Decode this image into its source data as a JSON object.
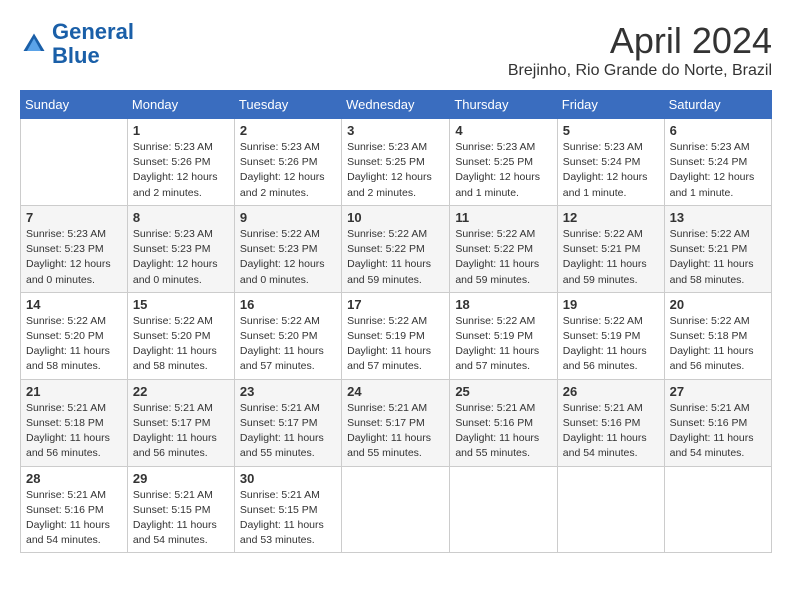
{
  "header": {
    "logo_line1": "General",
    "logo_line2": "Blue",
    "month_title": "April 2024",
    "subtitle": "Brejinho, Rio Grande do Norte, Brazil"
  },
  "weekdays": [
    "Sunday",
    "Monday",
    "Tuesday",
    "Wednesday",
    "Thursday",
    "Friday",
    "Saturday"
  ],
  "weeks": [
    [
      {
        "day": "",
        "info": ""
      },
      {
        "day": "1",
        "info": "Sunrise: 5:23 AM\nSunset: 5:26 PM\nDaylight: 12 hours\nand 2 minutes."
      },
      {
        "day": "2",
        "info": "Sunrise: 5:23 AM\nSunset: 5:26 PM\nDaylight: 12 hours\nand 2 minutes."
      },
      {
        "day": "3",
        "info": "Sunrise: 5:23 AM\nSunset: 5:25 PM\nDaylight: 12 hours\nand 2 minutes."
      },
      {
        "day": "4",
        "info": "Sunrise: 5:23 AM\nSunset: 5:25 PM\nDaylight: 12 hours\nand 1 minute."
      },
      {
        "day": "5",
        "info": "Sunrise: 5:23 AM\nSunset: 5:24 PM\nDaylight: 12 hours\nand 1 minute."
      },
      {
        "day": "6",
        "info": "Sunrise: 5:23 AM\nSunset: 5:24 PM\nDaylight: 12 hours\nand 1 minute."
      }
    ],
    [
      {
        "day": "7",
        "info": "Sunrise: 5:23 AM\nSunset: 5:23 PM\nDaylight: 12 hours\nand 0 minutes."
      },
      {
        "day": "8",
        "info": "Sunrise: 5:23 AM\nSunset: 5:23 PM\nDaylight: 12 hours\nand 0 minutes."
      },
      {
        "day": "9",
        "info": "Sunrise: 5:22 AM\nSunset: 5:23 PM\nDaylight: 12 hours\nand 0 minutes."
      },
      {
        "day": "10",
        "info": "Sunrise: 5:22 AM\nSunset: 5:22 PM\nDaylight: 11 hours\nand 59 minutes."
      },
      {
        "day": "11",
        "info": "Sunrise: 5:22 AM\nSunset: 5:22 PM\nDaylight: 11 hours\nand 59 minutes."
      },
      {
        "day": "12",
        "info": "Sunrise: 5:22 AM\nSunset: 5:21 PM\nDaylight: 11 hours\nand 59 minutes."
      },
      {
        "day": "13",
        "info": "Sunrise: 5:22 AM\nSunset: 5:21 PM\nDaylight: 11 hours\nand 58 minutes."
      }
    ],
    [
      {
        "day": "14",
        "info": "Sunrise: 5:22 AM\nSunset: 5:20 PM\nDaylight: 11 hours\nand 58 minutes."
      },
      {
        "day": "15",
        "info": "Sunrise: 5:22 AM\nSunset: 5:20 PM\nDaylight: 11 hours\nand 58 minutes."
      },
      {
        "day": "16",
        "info": "Sunrise: 5:22 AM\nSunset: 5:20 PM\nDaylight: 11 hours\nand 57 minutes."
      },
      {
        "day": "17",
        "info": "Sunrise: 5:22 AM\nSunset: 5:19 PM\nDaylight: 11 hours\nand 57 minutes."
      },
      {
        "day": "18",
        "info": "Sunrise: 5:22 AM\nSunset: 5:19 PM\nDaylight: 11 hours\nand 57 minutes."
      },
      {
        "day": "19",
        "info": "Sunrise: 5:22 AM\nSunset: 5:19 PM\nDaylight: 11 hours\nand 56 minutes."
      },
      {
        "day": "20",
        "info": "Sunrise: 5:22 AM\nSunset: 5:18 PM\nDaylight: 11 hours\nand 56 minutes."
      }
    ],
    [
      {
        "day": "21",
        "info": "Sunrise: 5:21 AM\nSunset: 5:18 PM\nDaylight: 11 hours\nand 56 minutes."
      },
      {
        "day": "22",
        "info": "Sunrise: 5:21 AM\nSunset: 5:17 PM\nDaylight: 11 hours\nand 56 minutes."
      },
      {
        "day": "23",
        "info": "Sunrise: 5:21 AM\nSunset: 5:17 PM\nDaylight: 11 hours\nand 55 minutes."
      },
      {
        "day": "24",
        "info": "Sunrise: 5:21 AM\nSunset: 5:17 PM\nDaylight: 11 hours\nand 55 minutes."
      },
      {
        "day": "25",
        "info": "Sunrise: 5:21 AM\nSunset: 5:16 PM\nDaylight: 11 hours\nand 55 minutes."
      },
      {
        "day": "26",
        "info": "Sunrise: 5:21 AM\nSunset: 5:16 PM\nDaylight: 11 hours\nand 54 minutes."
      },
      {
        "day": "27",
        "info": "Sunrise: 5:21 AM\nSunset: 5:16 PM\nDaylight: 11 hours\nand 54 minutes."
      }
    ],
    [
      {
        "day": "28",
        "info": "Sunrise: 5:21 AM\nSunset: 5:16 PM\nDaylight: 11 hours\nand 54 minutes."
      },
      {
        "day": "29",
        "info": "Sunrise: 5:21 AM\nSunset: 5:15 PM\nDaylight: 11 hours\nand 54 minutes."
      },
      {
        "day": "30",
        "info": "Sunrise: 5:21 AM\nSunset: 5:15 PM\nDaylight: 11 hours\nand 53 minutes."
      },
      {
        "day": "",
        "info": ""
      },
      {
        "day": "",
        "info": ""
      },
      {
        "day": "",
        "info": ""
      },
      {
        "day": "",
        "info": ""
      }
    ]
  ]
}
